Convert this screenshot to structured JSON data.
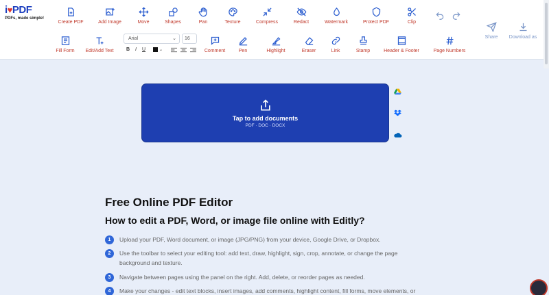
{
  "logo": {
    "brand_prefix": "i",
    "brand_suffix": "PDF",
    "tagline": "PDFs, made simple!"
  },
  "toolbar": {
    "row1": [
      {
        "label": "Create PDF",
        "icon": "file-plus-icon"
      },
      {
        "label": "Add Image",
        "icon": "image-plus-icon"
      },
      {
        "label": "Move",
        "icon": "move-icon"
      },
      {
        "label": "Shapes",
        "icon": "shapes-icon"
      },
      {
        "label": "Pan",
        "icon": "hand-icon"
      },
      {
        "label": "Texture",
        "icon": "palette-icon"
      },
      {
        "label": "Compress",
        "icon": "compress-icon"
      },
      {
        "label": "Redact",
        "icon": "eye-off-icon"
      },
      {
        "label": "Watermark",
        "icon": "droplet-icon"
      },
      {
        "label": "Protect PDF",
        "icon": "shield-icon"
      },
      {
        "label": "Clip",
        "icon": "scissors-icon"
      }
    ],
    "row2": [
      {
        "label": "Fill Form",
        "icon": "form-icon"
      },
      {
        "label": "Edit/Add Text",
        "icon": "text-plus-icon"
      },
      {
        "label": "Comment",
        "icon": "comment-plus-icon"
      },
      {
        "label": "Pen",
        "icon": "pen-icon"
      },
      {
        "label": "Highlight",
        "icon": "highlighter-icon"
      },
      {
        "label": "Eraser",
        "icon": "eraser-icon"
      },
      {
        "label": "Link",
        "icon": "link-icon"
      },
      {
        "label": "Stamp",
        "icon": "stamp-icon"
      },
      {
        "label": "Header & Footer",
        "icon": "header-footer-icon"
      },
      {
        "label": "Page Numbers",
        "icon": "hash-icon"
      }
    ],
    "share_label": "Share",
    "download_label": "Download as",
    "font_family": "Arial",
    "font_size": "16",
    "bold": "B",
    "italic": "I",
    "underline": "U",
    "text_color": "#111111",
    "accent_color": "#c0392b"
  },
  "upload": {
    "title": "Tap to add documents",
    "formats": "PDF · DOC · DOCX",
    "background_color": "#1e3fb1",
    "sources": [
      "google-drive-icon",
      "dropbox-icon",
      "onedrive-icon"
    ]
  },
  "content": {
    "title": "Free Online PDF Editor",
    "subtitle": "How to edit a PDF, Word, or image file online with Editly?",
    "steps": [
      {
        "num": "1",
        "text": "Upload your PDF, Word document, or image (JPG/PNG) from your device, Google Drive, or Dropbox."
      },
      {
        "num": "2",
        "text": "Use the toolbar to select your editing tool: add text, draw, highlight, sign, crop, annotate, or change the page background and texture."
      },
      {
        "num": "3",
        "text": "Navigate between pages using the panel on the right. Add, delete, or reorder pages as needed."
      },
      {
        "num": "4",
        "text": "Make your changes - edit text blocks, insert images, add comments, highlight content, fill forms, move elements, or"
      }
    ]
  }
}
